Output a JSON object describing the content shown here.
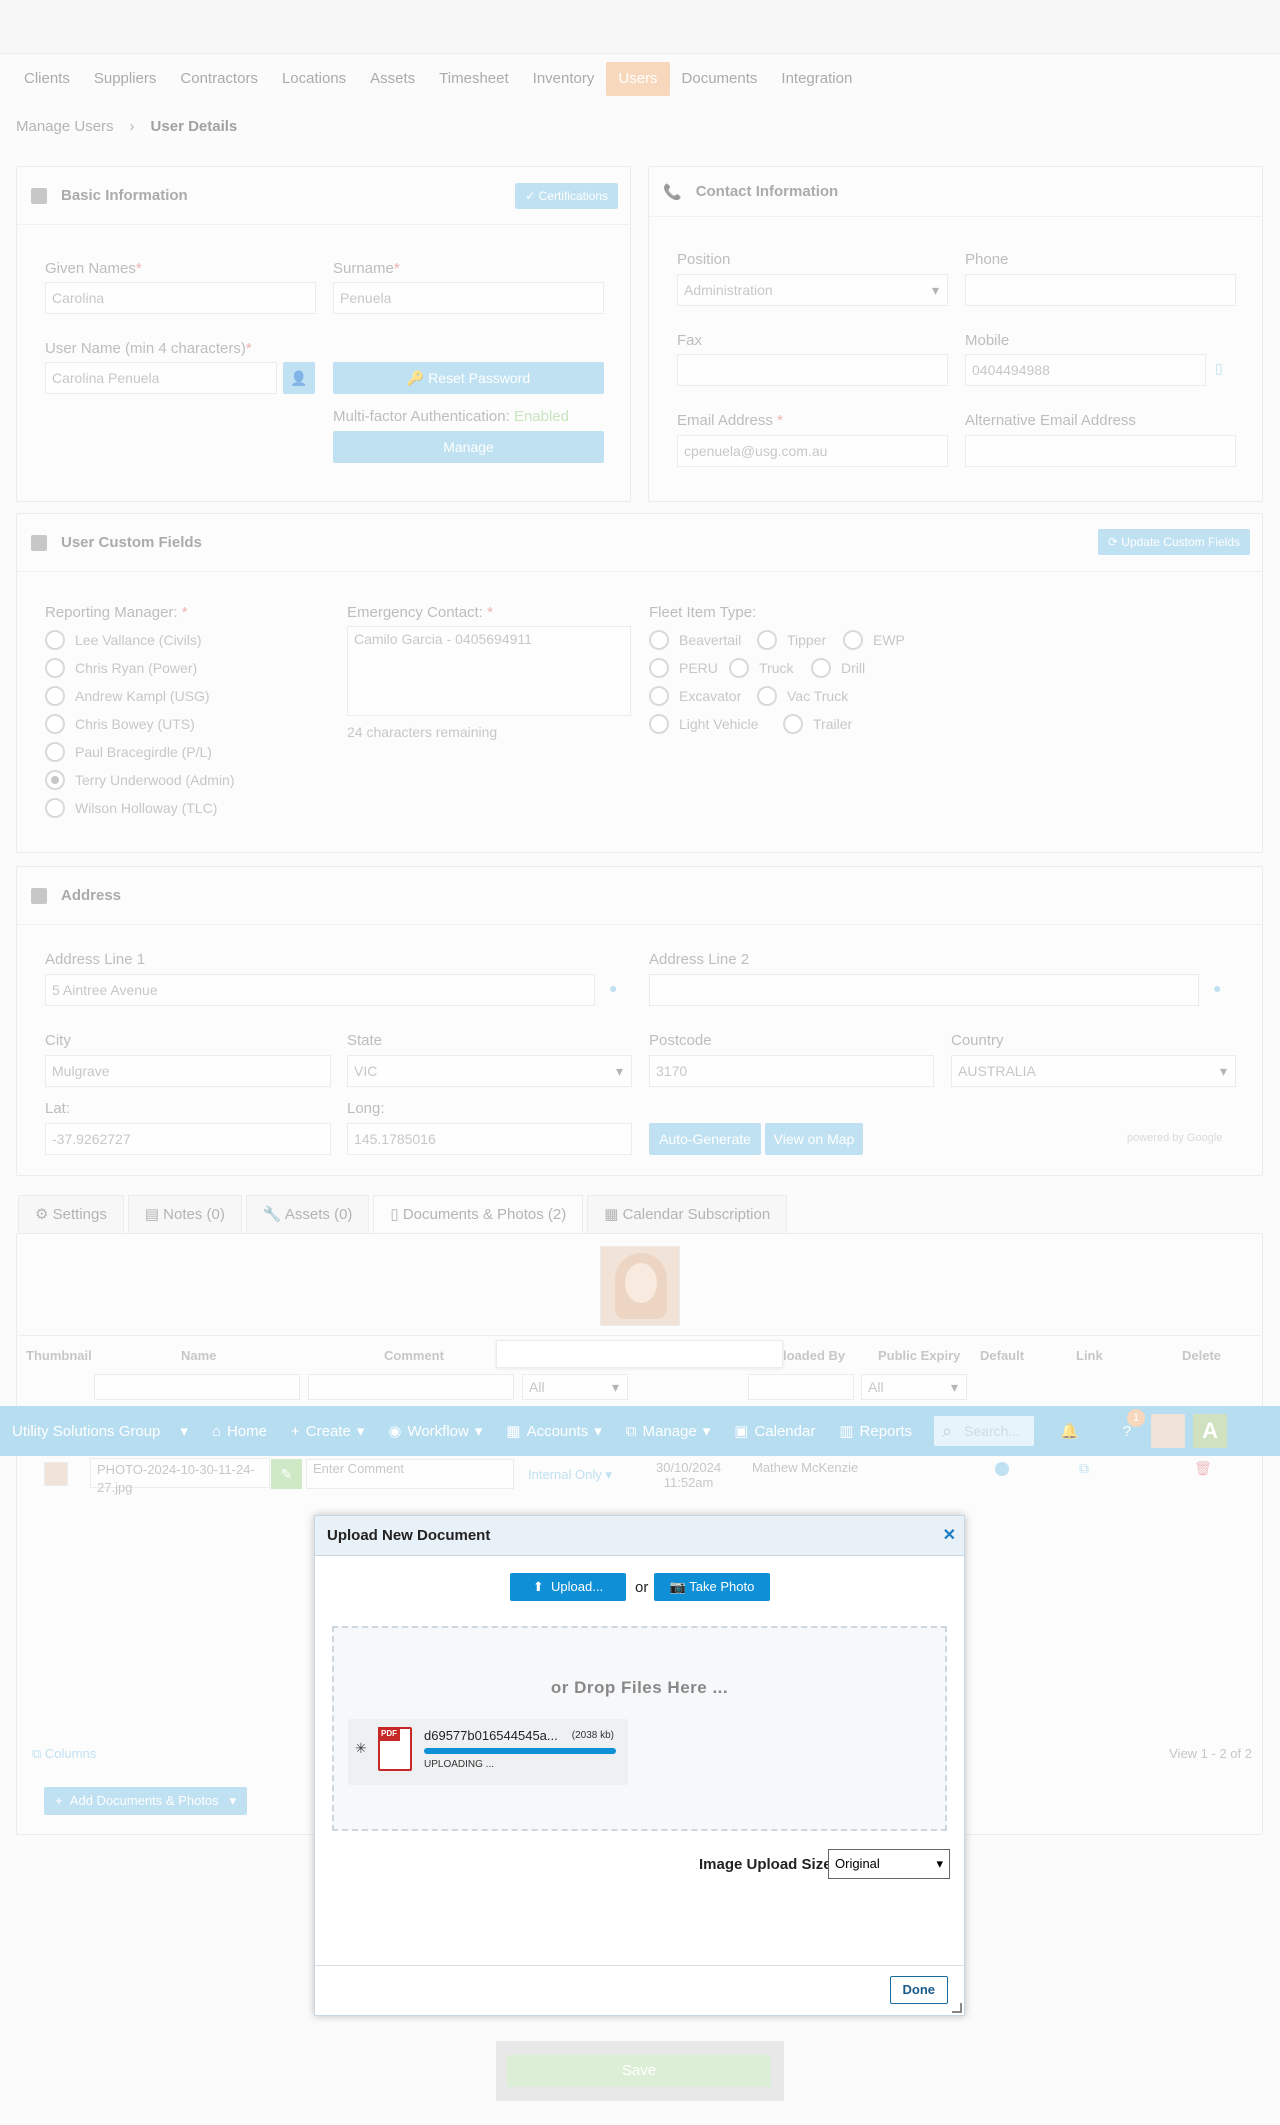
{
  "menu": [
    "Clients",
    "Suppliers",
    "Contractors",
    "Locations",
    "Assets",
    "Timesheet",
    "Inventory",
    "Users",
    "Documents",
    "Integration"
  ],
  "menu_active": "Users",
  "breadcrumb": {
    "parent": "Manage Users",
    "current": "User Details"
  },
  "basic": {
    "title": "Basic Information",
    "cert_btn": "Certifications",
    "given_label": "Given Names",
    "given_value": "Carolina",
    "surname_label": "Surname",
    "surname_value": "Penuela",
    "username_label": "User Name (min 4 characters)",
    "username_value": "Carolina Penuela",
    "reset_btn": "Reset Password",
    "mfa_label": "Multi-factor Authentication:",
    "mfa_status": "Enabled",
    "manage_btn": "Manage",
    "required_mark": "*"
  },
  "contact": {
    "title": "Contact Information",
    "position_label": "Position",
    "position_value": "Administration",
    "phone_label": "Phone",
    "fax_label": "Fax",
    "mobile_label": "Mobile",
    "mobile_value": "0404494988",
    "email_label": "Email Address",
    "email_value": "cpenuela@usg.com.au",
    "alt_email_label": "Alternative Email Address"
  },
  "custom": {
    "title": "User Custom Fields",
    "update_btn": "Update Custom Fields",
    "manager_label": "Reporting Manager:",
    "managers": [
      "Lee Vallance (Civils)",
      "Chris Ryan (Power)",
      "Andrew Kampl (USG)",
      "Chris Bowey (UTS)",
      "Paul Bracegirdle (P/L)",
      "Terry Underwood (Admin)",
      "Wilson Holloway (TLC)"
    ],
    "manager_selected": 5,
    "emergency_label": "Emergency Contact:",
    "emergency_value": "Camilo Garcia - 0405694911",
    "emergency_hint": "24 characters remaining",
    "fleet_label": "Fleet Item Type:",
    "fleet": [
      "Beavertail",
      "Tipper",
      "EWP",
      "PERU",
      "Truck",
      "Drill",
      "Excavator",
      "Vac Truck",
      "Light Vehicle",
      "Trailer"
    ]
  },
  "address": {
    "title": "Address",
    "line1_label": "Address Line 1",
    "line1_value": "5 Aintree Avenue",
    "line2_label": "Address Line 2",
    "city_label": "City",
    "city_value": "Mulgrave",
    "state_label": "State",
    "state_value": "VIC",
    "postcode_label": "Postcode",
    "postcode_value": "3170",
    "country_label": "Country",
    "country_value": "AUSTRALIA",
    "lat_label": "Lat:",
    "lat_value": "-37.9262727",
    "long_label": "Long:",
    "long_value": "145.1785016",
    "autogen_btn": "Auto-Generate",
    "map_btn": "View on Map",
    "powered": "powered by Google"
  },
  "tabs": [
    "Settings",
    "Notes (0)",
    "Assets (0)",
    "Documents & Photos (2)",
    "Calendar Subscription"
  ],
  "docs_table": {
    "headers": [
      "Thumbnail",
      "Name",
      "Comment",
      "loaded By",
      "Public Expiry",
      "Default",
      "Link",
      "Delete"
    ],
    "filter_all": "All",
    "row_name": "PHOTO-2024-10-30-11-24-27.jpg",
    "row_comment_placeholder": "Enter Comment",
    "row_visibility": "Internal Only",
    "row_date": "30/10/2024",
    "row_time": "11:52am",
    "row_by": "Mathew McKenzie",
    "columns_link": "Columns",
    "view_count": "View 1 - 2 of 2",
    "add_btn": "Add Documents & Photos"
  },
  "navbar": {
    "org": "Utility Solutions Group",
    "home": "Home",
    "create": "Create",
    "workflow": "Workflow",
    "accounts": "Accounts",
    "manage": "Manage",
    "calendar": "Calendar",
    "reports": "Reports",
    "search_placeholder": "Search...",
    "badge": "1"
  },
  "modal": {
    "title": "Upload New Document",
    "upload_btn": "Upload...",
    "or": "or",
    "photo_btn": "Take Photo",
    "drop_text": "or Drop Files Here ...",
    "file_name": "d69577b016544545a...",
    "file_size": "(2038 kb)",
    "file_status": "UPLOADING ...",
    "file_progress": 1.0,
    "size_label": "Image Upload Size:",
    "size_value": "Original",
    "done_btn": "Done"
  },
  "save_btn": "Save"
}
